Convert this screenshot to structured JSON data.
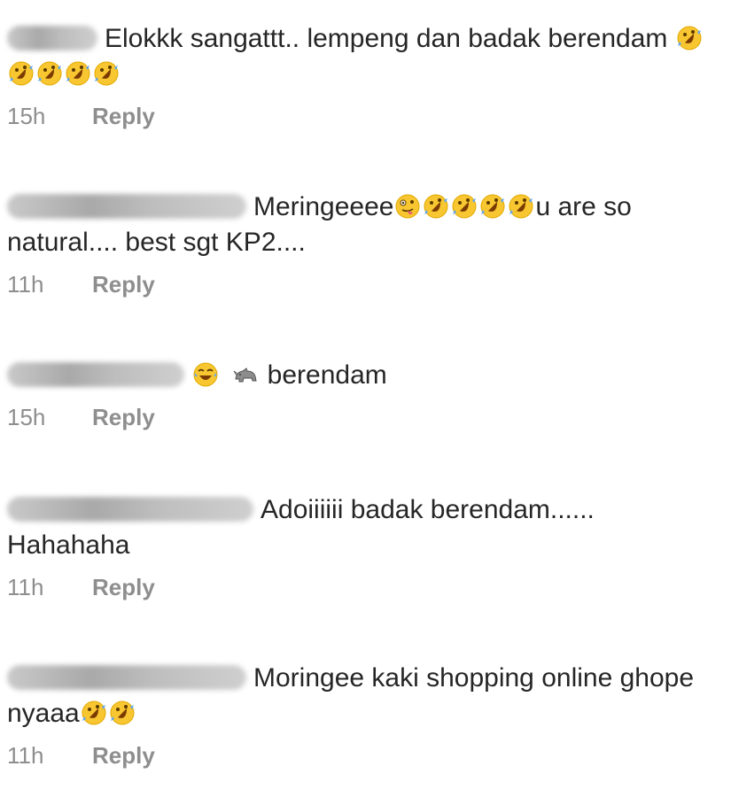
{
  "comments": [
    {
      "text_before": "Elokkk sangattt.. lempeng dan badak berendam",
      "emojis": [
        "rofl",
        "rofl",
        "rofl",
        "rofl",
        "rofl"
      ],
      "text_after": "",
      "time": "15h",
      "reply": "Reply"
    },
    {
      "text_before": "Meringeeee",
      "emojis": [
        "zany-face",
        "rofl",
        "rofl",
        "rofl",
        "rofl"
      ],
      "text_after": "u are so natural.... best sgt KP2....",
      "time": "11h",
      "reply": "Reply"
    },
    {
      "text_before": "",
      "emojis": [
        "joy",
        "rhinoceros"
      ],
      "text_after": " berendam",
      "time": "15h",
      "reply": "Reply"
    },
    {
      "text_before": "Adoiiiiii badak berendam...... Hahahaha",
      "emojis": [],
      "text_after": "",
      "time": "11h",
      "reply": "Reply"
    },
    {
      "text_before": "Moringee kaki shopping online ghope nyaaa",
      "emojis": [
        "rofl",
        "rofl"
      ],
      "text_after": "",
      "time": "11h",
      "reply": "Reply"
    }
  ]
}
